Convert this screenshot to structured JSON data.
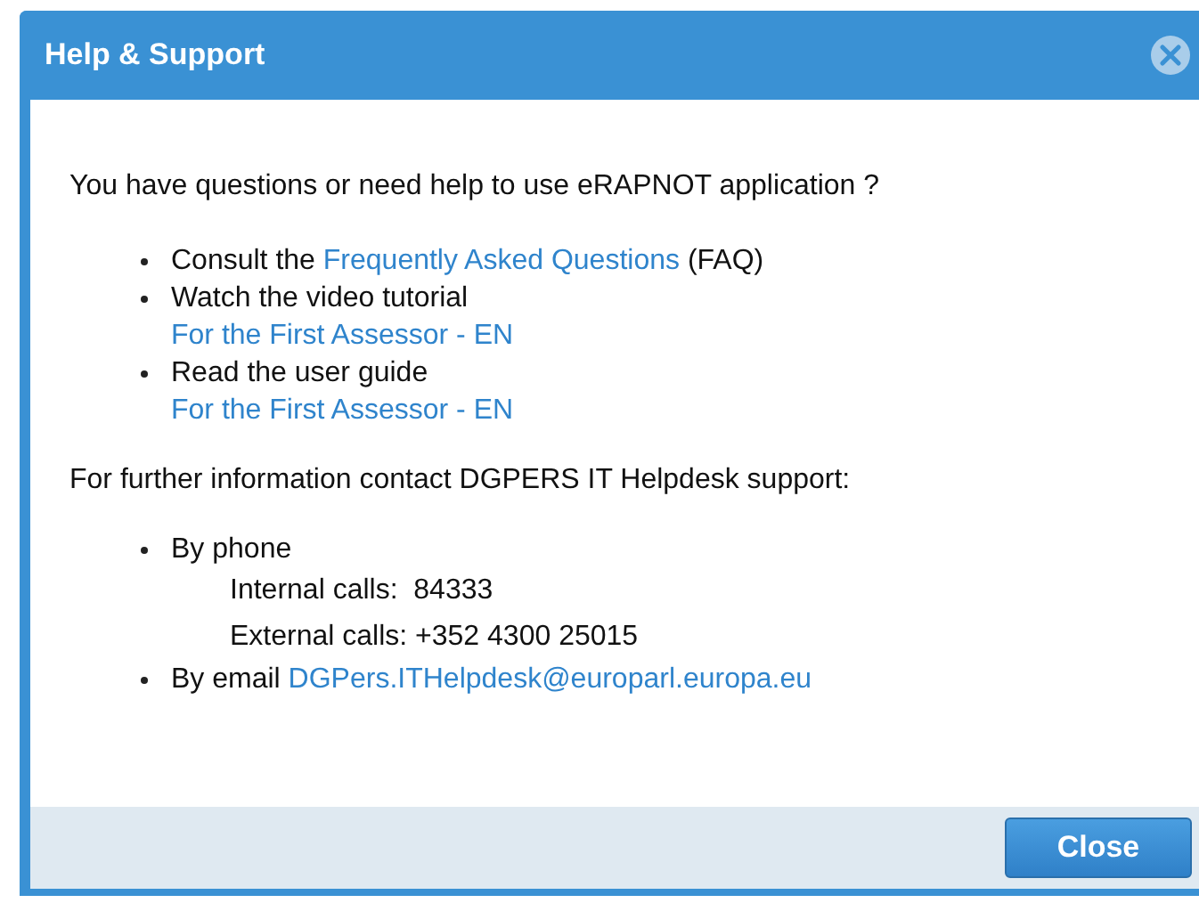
{
  "dialog": {
    "title": "Help & Support",
    "intro": "You have questions or need help to use eRAPNOT application ?",
    "help_items": [
      {
        "parts": [
          {
            "kind": "text",
            "text": "Consult the "
          },
          {
            "kind": "link",
            "text": "Frequently Asked Questions"
          },
          {
            "kind": "text",
            "text": " (FAQ)"
          }
        ]
      },
      {
        "parts": [
          {
            "kind": "text",
            "text": "Watch the video tutorial"
          }
        ],
        "sub": [
          {
            "kind": "link",
            "text": "For the First Assessor - EN"
          }
        ]
      },
      {
        "parts": [
          {
            "kind": "text",
            "text": "Read the user guide"
          }
        ],
        "sub": [
          {
            "kind": "link",
            "text": "For the First Assessor - EN"
          }
        ]
      }
    ],
    "contact_heading": "For further information contact DGPERS IT Helpdesk support:",
    "contact_items": [
      {
        "parts": [
          {
            "kind": "text",
            "text": "By phone"
          }
        ],
        "sub": [
          {
            "kind": "text",
            "text": "Internal calls:  84333"
          },
          {
            "kind": "text",
            "text": "External calls: +352 4300 25015"
          }
        ]
      },
      {
        "parts": [
          {
            "kind": "text",
            "text": "By email "
          },
          {
            "kind": "link",
            "text": "DGPers.ITHelpdesk@europarl.europa.eu"
          }
        ]
      }
    ],
    "buttons": [
      "Close"
    ]
  }
}
